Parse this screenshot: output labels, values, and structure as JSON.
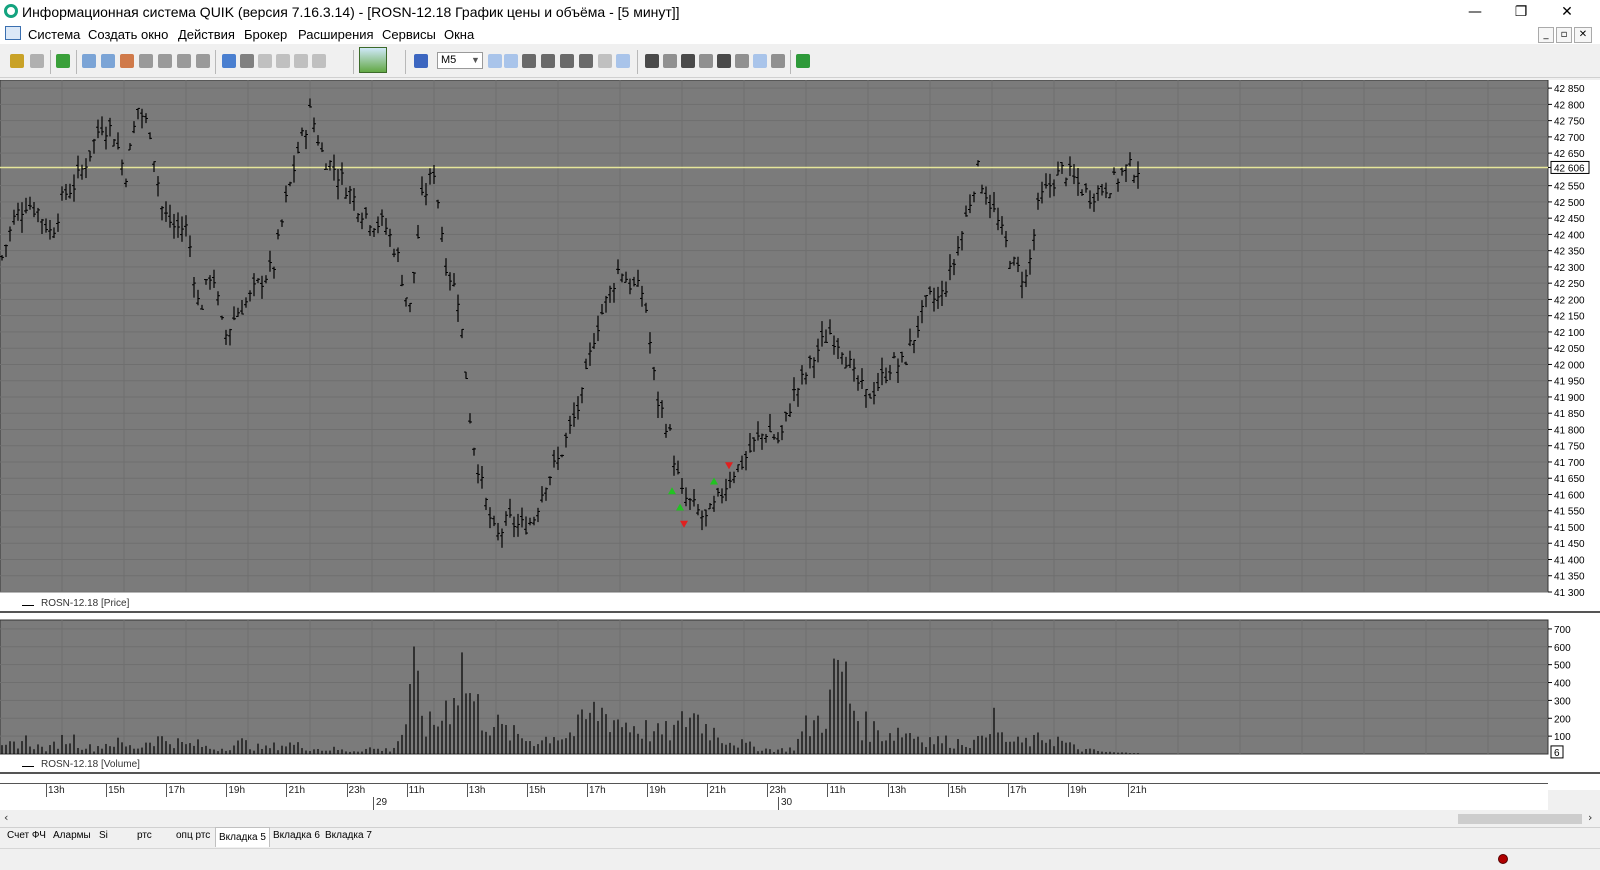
{
  "window": {
    "title": "Информационная система QUIK (версия 7.16.3.14) - [ROSN-12.18 График цены и объёма - [5 минут]]",
    "minimize_glyph": "—",
    "restore_glyph": "❐",
    "close_glyph": "✕"
  },
  "menu": {
    "items": [
      "Система",
      "Создать окно",
      "Действия",
      "Брокер",
      "Расширения",
      "Сервисы",
      "Окна"
    ],
    "mdi_glyphs": [
      "_",
      "▫",
      "✕"
    ]
  },
  "toolbar": {
    "interval_value": "M5"
  },
  "price_axis": {
    "ticks": [
      "42 850",
      "42 800",
      "42 750",
      "42 700",
      "42 650",
      "42 606",
      "42 550",
      "42 500",
      "42 450",
      "42 400",
      "42 350",
      "42 300",
      "42 250",
      "42 200",
      "42 150",
      "42 100",
      "42 050",
      "42 000",
      "41 950",
      "41 900",
      "41 850",
      "41 800",
      "41 750",
      "41 700",
      "41 650",
      "41 600",
      "41 550",
      "41 500",
      "41 450",
      "41 400",
      "41 350",
      "41 300"
    ],
    "current_price_label": "42 606"
  },
  "volume_axis": {
    "ticks": [
      "700",
      "600",
      "500",
      "400",
      "300",
      "200",
      "100"
    ],
    "last_volume": "6"
  },
  "legend": {
    "price": "ROSN-12.18 [Price]",
    "volume": "ROSN-12.18 [Volume]"
  },
  "time_axis": {
    "labels": [
      "13h",
      "15h",
      "17h",
      "19h",
      "21h",
      "23h",
      "11h",
      "13h",
      "15h",
      "17h",
      "19h",
      "21h",
      "23h",
      "11h",
      "13h",
      "15h",
      "17h",
      "19h",
      "21h"
    ],
    "dates": [
      "29",
      "30"
    ]
  },
  "tabs": {
    "items": [
      "Счет ФЧ",
      "Алармы",
      "Si",
      "ртс",
      "опц ртс",
      "Вкладка 5",
      "Вкладка 6",
      "Вкладка 7"
    ],
    "active_index": 5
  },
  "colors": {
    "chart_bg": "#7b7b7b",
    "bar_color": "#000000",
    "price_line": "#e6e69a",
    "buy_marker": "#22c322",
    "sell_marker": "#e02020"
  },
  "chart_data": [
    {
      "type": "bar",
      "title": "ROSN-12.18 [Price]",
      "ylim": [
        41300,
        42875
      ],
      "current_price": 42606,
      "close_path": [
        42330,
        42450,
        42500,
        42470,
        42400,
        42520,
        42560,
        42640,
        42740,
        42720,
        42580,
        42790,
        42720,
        42470,
        42420,
        42420,
        42160,
        42300,
        42080,
        42160,
        42200,
        42260,
        42300,
        42500,
        42660,
        42780,
        42640,
        42600,
        42540,
        42480,
        42440,
        42430,
        42340,
        42160,
        42500,
        42600,
        42300,
        42200,
        41800,
        41600,
        41460,
        41520,
        41500,
        41520,
        41640,
        41700,
        41800,
        41900,
        42100,
        42200,
        42300,
        42240,
        42220,
        41900,
        41800,
        41600,
        41560,
        41520,
        41580,
        41660,
        41700,
        41760,
        41800,
        41760,
        41900,
        41960,
        42040,
        42100,
        42060,
        41960,
        41900,
        41940,
        42000,
        42000,
        42100,
        42200,
        42200,
        42300,
        42440,
        42600,
        42500,
        42400,
        42300,
        42260,
        42500,
        42560,
        42600,
        42560,
        42520,
        42540,
        42560,
        42600,
        42606
      ],
      "volume_ylim": [
        0,
        750
      ],
      "volume_values": [
        40,
        70,
        100,
        55,
        30,
        90,
        120,
        60,
        40,
        70,
        80,
        50,
        45,
        110,
        100,
        90,
        60,
        70,
        40,
        35,
        60,
        80,
        50,
        40,
        60,
        70,
        55,
        40,
        30,
        35,
        20,
        25,
        40,
        30,
        30,
        160,
        520,
        180,
        220,
        380,
        620,
        360,
        260,
        200,
        150,
        120,
        100,
        90,
        140,
        120,
        160,
        250,
        300,
        270,
        220,
        200,
        170,
        140,
        150,
        180,
        300,
        220,
        160,
        110,
        80,
        60,
        40,
        30,
        30,
        40,
        180,
        220,
        320,
        640,
        360,
        200,
        170,
        140,
        160,
        150,
        120,
        100,
        90,
        80,
        90,
        70,
        290,
        120,
        80,
        80,
        90,
        120,
        100,
        60,
        30,
        25,
        15,
        10,
        8,
        6
      ],
      "volume_label": "ROSN-12.18 [Volume]"
    }
  ]
}
